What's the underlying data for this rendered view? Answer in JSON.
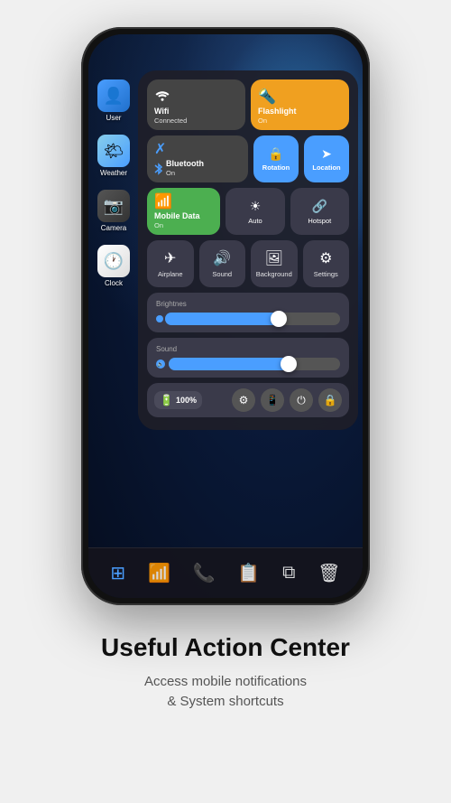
{
  "phone": {
    "apps": [
      {
        "id": "user",
        "icon": "👤",
        "label": "User",
        "class": "app-user"
      },
      {
        "id": "weather",
        "icon": "🌤",
        "label": "Weather",
        "class": "app-weather"
      },
      {
        "id": "camera",
        "icon": "📷",
        "label": "Camera",
        "class": "app-camera"
      },
      {
        "id": "clock",
        "icon": "🕐",
        "label": "Clock",
        "class": "app-clock"
      }
    ],
    "control_center": {
      "tiles_row1": [
        {
          "id": "wifi",
          "icon": "wifi",
          "label": "Wifi",
          "sub": "Connected",
          "class": "tile-wifi"
        },
        {
          "id": "flashlight",
          "icon": "flashlight",
          "label": "Flashlight",
          "sub": "On",
          "class": "tile-flashlight"
        }
      ],
      "tiles_row2": [
        {
          "id": "bluetooth",
          "icon": "bluetooth",
          "label": "Bluetooth",
          "sub": "On",
          "class": "tile-bluetooth"
        },
        {
          "id": "rotation",
          "icon": "rotation",
          "label": "Rotation",
          "class": "tile-square"
        },
        {
          "id": "location",
          "icon": "location",
          "label": "Location",
          "class": "tile-square"
        }
      ],
      "tiles_row3": [
        {
          "id": "mobile-data",
          "icon": "signal",
          "label": "Mobile Data",
          "sub": "On",
          "class": "tile-mobile-data"
        },
        {
          "id": "auto",
          "icon": "sun",
          "label": "Auto",
          "class": "tile-auto"
        },
        {
          "id": "hotspot",
          "icon": "hotspot",
          "label": "Hotspot",
          "class": "tile-auto"
        }
      ],
      "tiles_row4": [
        {
          "id": "airplane",
          "icon": "✈",
          "label": "Airplane"
        },
        {
          "id": "sound",
          "icon": "🔊",
          "label": "Sound"
        },
        {
          "id": "background",
          "icon": "🖼",
          "label": "Background"
        },
        {
          "id": "settings",
          "icon": "⚙",
          "label": "Settings"
        }
      ],
      "brightness": {
        "label": "Brightnes",
        "value": 65
      },
      "sound": {
        "label": "Sound",
        "value": 70
      },
      "battery": {
        "percentage": "100%",
        "icon": "🔋"
      }
    },
    "dock": [
      {
        "id": "finder",
        "icon": "⊞",
        "active": true
      },
      {
        "id": "signal",
        "icon": "📶",
        "active": false
      },
      {
        "id": "phone",
        "icon": "📞",
        "active": false
      },
      {
        "id": "notes",
        "icon": "📋",
        "active": false
      },
      {
        "id": "multitask",
        "icon": "⧉",
        "active": false
      },
      {
        "id": "trash",
        "icon": "🗑",
        "active": false
      }
    ]
  },
  "footer": {
    "title": "Useful Action Center",
    "subtitle": "Access mobile notifications\n& System shortcuts"
  }
}
